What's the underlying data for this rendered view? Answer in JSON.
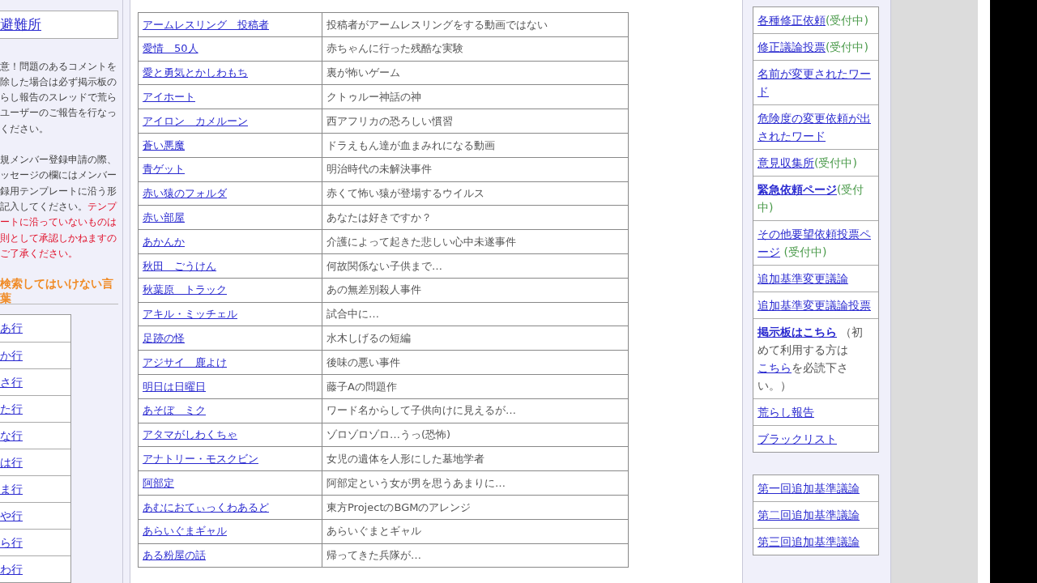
{
  "left_panel": {
    "top_link": "避難所",
    "notices": [
      {
        "lines": [
          [
            {
              "text": "意！問題のあるコメントを",
              "kind": "normal"
            }
          ],
          [
            {
              "text": "除した場合は必ず掲示板の",
              "kind": "normal"
            }
          ],
          [
            {
              "text": "らし報告のスレッドで荒ら",
              "kind": "normal"
            }
          ],
          [
            {
              "text": "ユーザーのご報告を行なっ",
              "kind": "normal"
            }
          ],
          [
            {
              "text": "ください。",
              "kind": "normal"
            }
          ]
        ]
      },
      {
        "lines": [
          [
            {
              "text": "規メンバー登録申請の際、",
              "kind": "normal"
            }
          ],
          [
            {
              "text": "ッセージの欄にはメンバー",
              "kind": "normal"
            }
          ],
          [
            {
              "text": "録用テンプレートに沿う形",
              "kind": "normal"
            }
          ],
          [
            {
              "text": "記入してください。",
              "kind": "normal"
            },
            {
              "text": "テンプ",
              "kind": "warning"
            }
          ],
          [
            {
              "text": "ートに沿っていないものは",
              "kind": "warning"
            }
          ],
          [
            {
              "text": "則として承認しかねますの",
              "kind": "warning"
            }
          ],
          [
            {
              "text": "ご了承ください。",
              "kind": "warning"
            }
          ]
        ]
      }
    ],
    "heading_lines": [
      "検索してはいけない言",
      "葉"
    ],
    "index_links": [
      "あ行",
      "か行",
      "さ行",
      "た行",
      "な行",
      "は行",
      "ま行",
      "や行",
      "ら行",
      "わ行"
    ]
  },
  "table": {
    "rows": [
      [
        "アームレスリング　投稿者",
        "投稿者がアームレスリングをする動画ではない"
      ],
      [
        "愛情　50人",
        "赤ちゃんに行った残酷な実験"
      ],
      [
        "愛と勇気とかしわもち",
        "裏が怖いゲーム"
      ],
      [
        "アイホート",
        "クトゥルー神話の神"
      ],
      [
        "アイロン　カメルーン",
        "西アフリカの恐ろしい慣習"
      ],
      [
        "蒼い悪魔",
        "ドラえもん達が血まみれになる動画"
      ],
      [
        "青ゲット",
        "明治時代の未解決事件"
      ],
      [
        "赤い猿のフォルダ",
        "赤くて怖い猿が登場するウイルス"
      ],
      [
        "赤い部屋",
        "あなたは好きですか？"
      ],
      [
        "あかんか",
        "介護によって起きた悲しい心中未遂事件"
      ],
      [
        "秋田　ごうけん",
        "何故関係ない子供まで…"
      ],
      [
        "秋葉原　トラック",
        "あの無差別殺人事件"
      ],
      [
        "アキル・ミッチェル",
        "試合中に…"
      ],
      [
        "足跡の怪",
        "水木しげるの短編"
      ],
      [
        "アジサイ　鹿よけ",
        "後味の悪い事件"
      ],
      [
        "明日は日曜日",
        "藤子Aの問題作"
      ],
      [
        "あそぼ　ミク",
        "ワード名からして子供向けに見えるが…"
      ],
      [
        "アタマがしわくちゃ",
        "ゾロゾロゾロ…うっ(恐怖)"
      ],
      [
        "アナトリー・モスクビン",
        "女児の遺体を人形にした墓地学者"
      ],
      [
        "阿部定",
        "阿部定という女が男を思うあまりに…"
      ],
      [
        "あむにおてぃっくわあるど",
        "東方ProjectのBGMのアレンジ"
      ],
      [
        "あらいぐまギャル",
        "あらいぐまとギャル"
      ],
      [
        "ある粉屋の話",
        "帰ってきた兵隊が…"
      ]
    ]
  },
  "right_panel": {
    "groups": [
      {
        "items": [
          {
            "parts": [
              {
                "text": "各種修正依頼",
                "kind": "link"
              },
              {
                "text": "(受付中)",
                "kind": "status"
              }
            ]
          },
          {
            "parts": [
              {
                "text": "修正議論投票",
                "kind": "link"
              },
              {
                "text": "(受付中)",
                "kind": "status"
              }
            ]
          },
          {
            "parts": [
              {
                "text": "名前が変更されたワード",
                "kind": "link"
              }
            ]
          },
          {
            "parts": [
              {
                "text": "危険度の変更依頼が出されたワード",
                "kind": "link"
              }
            ]
          },
          {
            "parts": [
              {
                "text": "意見収集所",
                "kind": "link"
              },
              {
                "text": "(受付中)",
                "kind": "status"
              }
            ]
          },
          {
            "parts": [
              {
                "text": "緊急依頼ページ",
                "kind": "bold_link"
              },
              {
                "text": "(受付中)",
                "kind": "status"
              }
            ]
          },
          {
            "parts": [
              {
                "text": "その他要望依頼投票ページ",
                "kind": "link"
              },
              {
                "text": " (受付中)",
                "kind": "status"
              }
            ]
          },
          {
            "parts": [
              {
                "text": "追加基準変更議論",
                "kind": "link"
              }
            ]
          },
          {
            "parts": [
              {
                "text": "追加基準変更議論投票",
                "kind": "link"
              }
            ]
          },
          {
            "parts": [
              {
                "text": "掲示板はこちら",
                "kind": "bold_link"
              },
              {
                "text": " （初めて利用する方は",
                "kind": "plain"
              },
              {
                "text": "こちら",
                "kind": "link"
              },
              {
                "text": "を必読下さい。）",
                "kind": "plain"
              }
            ]
          },
          {
            "parts": [
              {
                "text": "荒らし報告",
                "kind": "link"
              }
            ]
          },
          {
            "parts": [
              {
                "text": "ブラックリスト",
                "kind": "link"
              }
            ]
          }
        ]
      },
      {
        "items": [
          {
            "parts": [
              {
                "text": "第一回追加基準議論",
                "kind": "link"
              }
            ]
          },
          {
            "parts": [
              {
                "text": "第二回追加基準議論",
                "kind": "link"
              }
            ]
          },
          {
            "parts": [
              {
                "text": "第三回追加基準議論",
                "kind": "link"
              }
            ]
          }
        ]
      }
    ]
  }
}
